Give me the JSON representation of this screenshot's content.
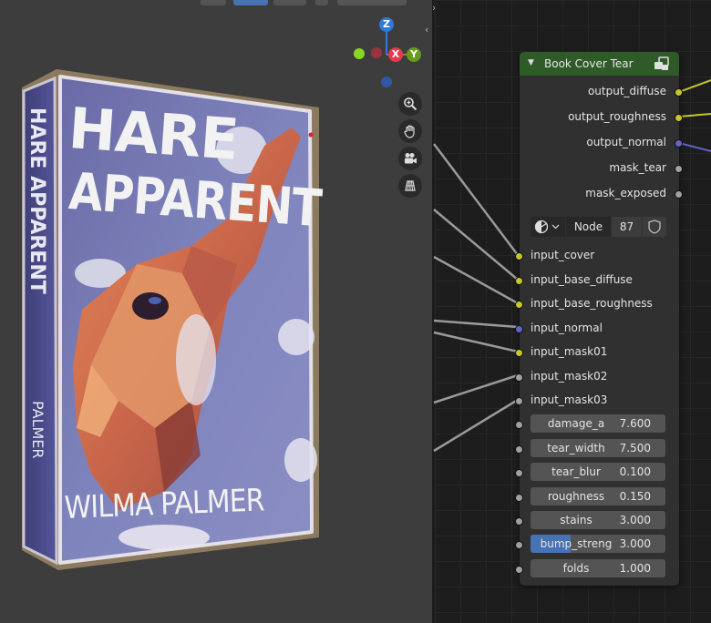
{
  "viewport": {
    "gizmo": {
      "z": "Z",
      "x": "X",
      "y": "Y"
    },
    "nav": [
      "zoom-icon",
      "hand-icon",
      "camera-icon",
      "grid-icon"
    ],
    "book": {
      "title_line1": "HARE",
      "title_line2": "APPARENT",
      "author": "WILMA PALMER",
      "spine_title": "HARE APPARENT",
      "spine_author": "PALMER"
    }
  },
  "node": {
    "title": "Book Cover Tear",
    "outputs": [
      {
        "label": "output_diffuse",
        "color": "#c7c729"
      },
      {
        "label": "output_roughness",
        "color": "#c7c729"
      },
      {
        "label": "output_normal",
        "color": "#6363c7"
      },
      {
        "label": "mask_tear",
        "color": "#a1a1a1"
      },
      {
        "label": "mask_exposed",
        "color": "#a1a1a1"
      }
    ],
    "group": {
      "type_label": "Node",
      "users": "87"
    },
    "inputs": [
      {
        "label": "input_cover",
        "color": "#c7c729"
      },
      {
        "label": "input_base_diffuse",
        "color": "#c7c729"
      },
      {
        "label": "input_base_roughness",
        "color": "#c7c729"
      },
      {
        "label": "input_normal",
        "color": "#6363c7"
      },
      {
        "label": "input_mask01",
        "color": "#c7c729"
      },
      {
        "label": "input_mask02",
        "color": "#a1a1a1"
      },
      {
        "label": "input_mask03",
        "color": "#a1a1a1"
      }
    ],
    "fields": [
      {
        "label": "damage_a",
        "value": "7.600"
      },
      {
        "label": "tear_width",
        "value": "7.500"
      },
      {
        "label": "tear_blur",
        "value": "0.100"
      },
      {
        "label": "roughness",
        "value": "0.150"
      },
      {
        "label": "stains",
        "value": "3.000"
      },
      {
        "label": "bump_streng",
        "value": "3.000",
        "fill_fraction": 0.3
      },
      {
        "label": "folds",
        "value": "1.000"
      }
    ]
  }
}
